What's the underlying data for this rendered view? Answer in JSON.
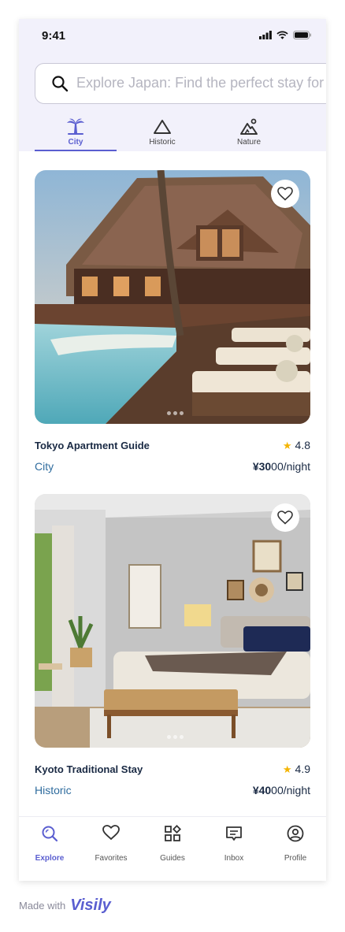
{
  "status_bar": {
    "time": "9:41"
  },
  "search": {
    "placeholder": "Explore Japan: Find the perfect stay for you"
  },
  "categories": [
    {
      "label": "City",
      "icon": "palm-tree-icon",
      "active": true
    },
    {
      "label": "Historic",
      "icon": "pyramid-icon",
      "active": false
    },
    {
      "label": "Nature",
      "icon": "mountain-icon",
      "active": false
    }
  ],
  "listings": [
    {
      "title": "Tokyo Apartment Guide",
      "rating": "4.8",
      "category": "City",
      "price_bold": "¥30",
      "price_rest": "00/night"
    },
    {
      "title": "Kyoto Traditional Stay",
      "rating": "4.9",
      "category": "Historic",
      "price_bold": "¥40",
      "price_rest": "00/night"
    }
  ],
  "tabs": [
    {
      "label": "Explore",
      "icon": "explore-search-icon",
      "active": true
    },
    {
      "label": "Favorites",
      "icon": "heart-icon",
      "active": false
    },
    {
      "label": "Guides",
      "icon": "grid-icon",
      "active": false
    },
    {
      "label": "Inbox",
      "icon": "message-icon",
      "active": false
    },
    {
      "label": "Profile",
      "icon": "profile-icon",
      "active": false
    }
  ],
  "footer": {
    "made_with": "Made with",
    "brand": "Visily"
  },
  "colors": {
    "accent": "#5a5ed0",
    "header_bg": "#f2f1fb",
    "star": "#f4b400",
    "category_text": "#2f6c9e"
  }
}
